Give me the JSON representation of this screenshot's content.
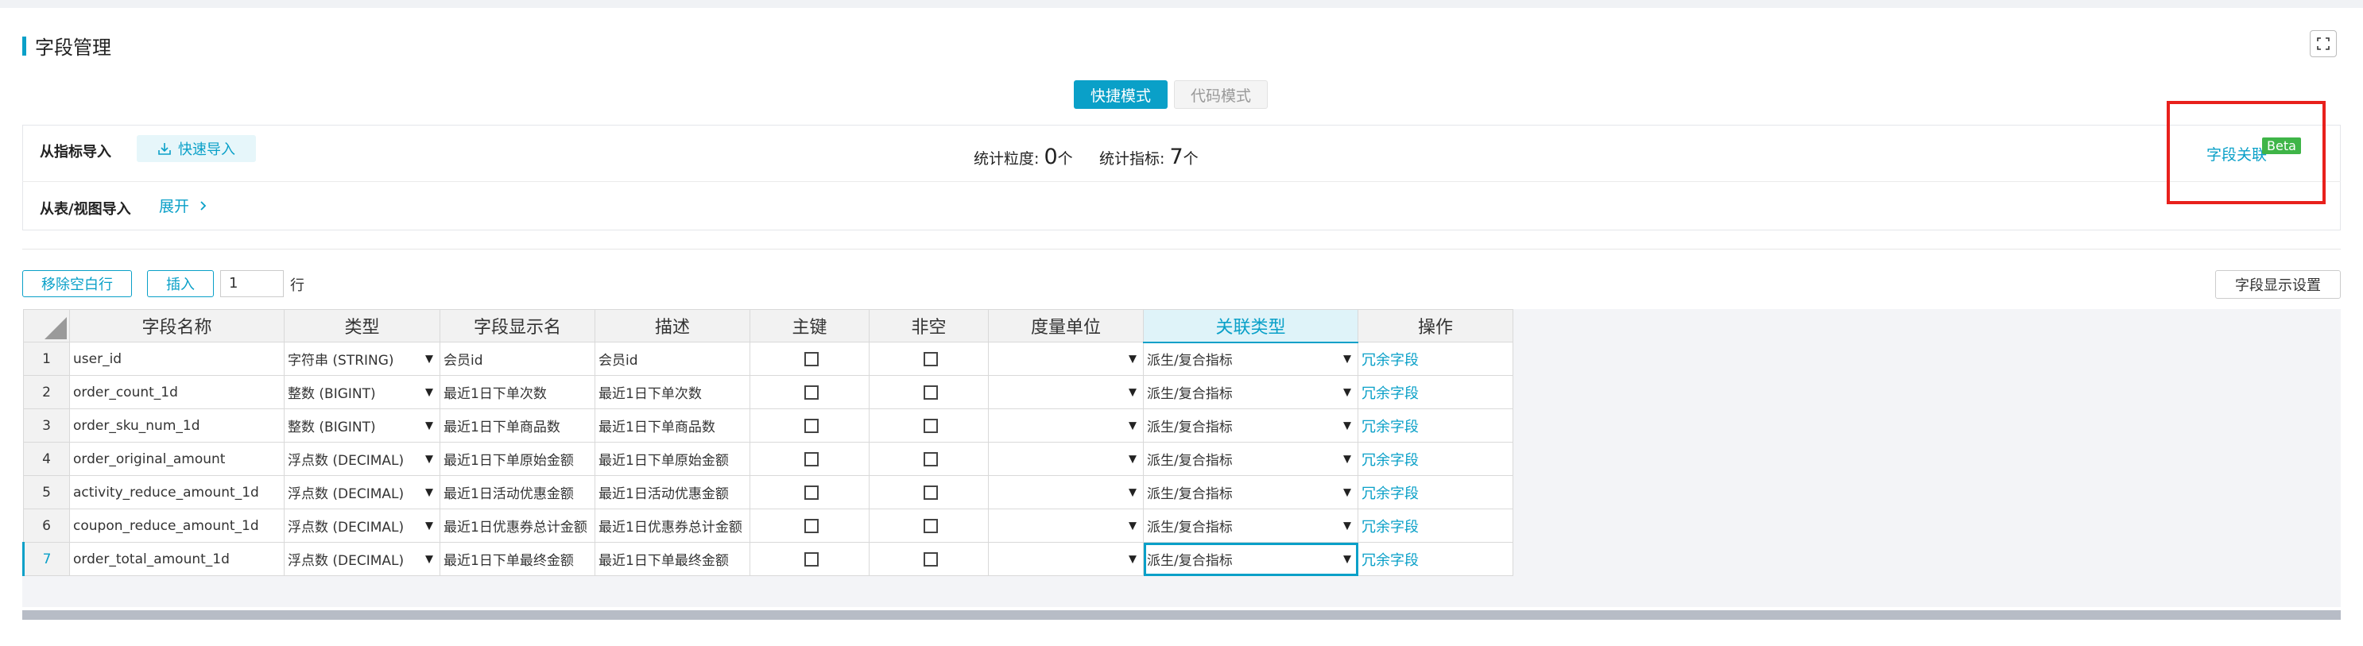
{
  "page": {
    "title": "字段管理",
    "fullscreen_icon": "fullscreen-icon"
  },
  "mode_switch": {
    "quick": "快捷模式",
    "code": "代码模式"
  },
  "import_panel": {
    "from_metric": "从指标导入",
    "quick_import": "快速导入",
    "quick_import_icon": "import-icon",
    "stat_granularity_label": "统计粒度:",
    "stat_granularity_value": "0",
    "stat_metric_label": "统计指标:",
    "stat_metric_value": "7",
    "unit": "个",
    "from_table": "从表/视图导入",
    "expand": "展开",
    "expand_icon": "chevron-right-icon",
    "field_link": "字段关联",
    "beta": "Beta",
    "annotation_color": "#e8201c"
  },
  "toolbar": {
    "remove_blank": "移除空白行",
    "insert": "插入",
    "row_count": "1",
    "row_unit": "行",
    "display_settings": "字段显示设置"
  },
  "grid": {
    "headers": [
      "字段名称",
      "类型",
      "字段显示名",
      "描述",
      "主键",
      "非空",
      "度量单位",
      "关联类型",
      "操作"
    ],
    "rows": [
      {
        "num": "1",
        "name": "user_id",
        "type": "字符串 (STRING)",
        "display": "会员id",
        "desc": "会员id",
        "pk": false,
        "notnull": false,
        "unit": "",
        "relation": "派生/复合指标",
        "op": "冗余字段"
      },
      {
        "num": "2",
        "name": "order_count_1d",
        "type": "整数 (BIGINT)",
        "display": "最近1日下单次数",
        "desc": "最近1日下单次数",
        "pk": false,
        "notnull": false,
        "unit": "",
        "relation": "派生/复合指标",
        "op": "冗余字段"
      },
      {
        "num": "3",
        "name": "order_sku_num_1d",
        "type": "整数 (BIGINT)",
        "display": "最近1日下单商品数",
        "desc": "最近1日下单商品数",
        "pk": false,
        "notnull": false,
        "unit": "",
        "relation": "派生/复合指标",
        "op": "冗余字段"
      },
      {
        "num": "4",
        "name": "order_original_amount",
        "type": "浮点数 (DECIMAL)",
        "display": "最近1日下单原始金额",
        "desc": "最近1日下单原始金额",
        "pk": false,
        "notnull": false,
        "unit": "",
        "relation": "派生/复合指标",
        "op": "冗余字段"
      },
      {
        "num": "5",
        "name": "activity_reduce_amount_1d",
        "type": "浮点数 (DECIMAL)",
        "display": "最近1日活动优惠金额",
        "desc": "最近1日活动优惠金额",
        "pk": false,
        "notnull": false,
        "unit": "",
        "relation": "派生/复合指标",
        "op": "冗余字段"
      },
      {
        "num": "6",
        "name": "coupon_reduce_amount_1d",
        "type": "浮点数 (DECIMAL)",
        "display": "最近1日优惠券总计金额",
        "desc": "最近1日优惠券总计金额",
        "pk": false,
        "notnull": false,
        "unit": "",
        "relation": "派生/复合指标",
        "op": "冗余字段"
      },
      {
        "num": "7",
        "name": "order_total_amount_1d",
        "type": "浮点数 (DECIMAL)",
        "display": "最近1日下单最终金额",
        "desc": "最近1日下单最终金额",
        "pk": false,
        "notnull": false,
        "unit": "",
        "relation": "派生/复合指标",
        "op": "冗余字段"
      }
    ],
    "active_row": "7",
    "highlight_header": "关联类型",
    "accent_color": "#0aa0c8"
  }
}
